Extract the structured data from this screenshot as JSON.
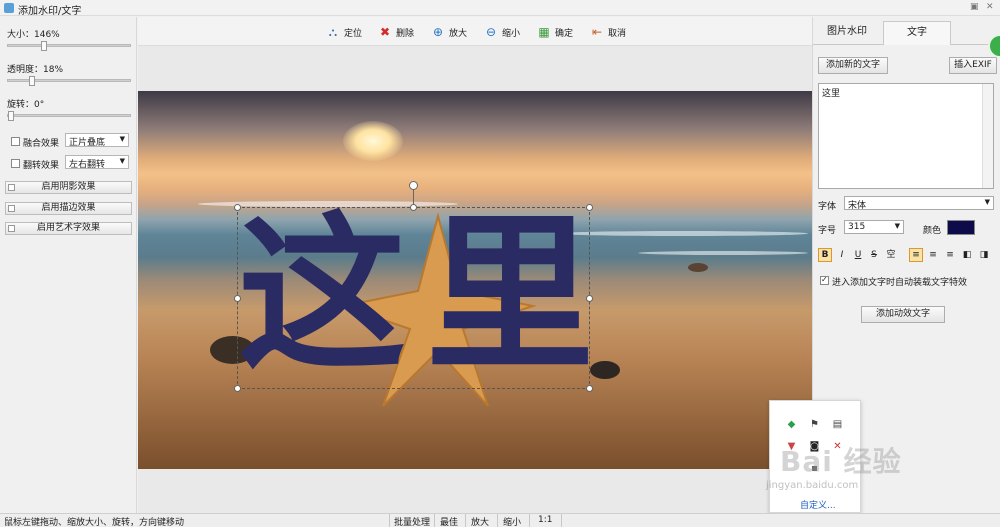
{
  "window": {
    "title": "添加水印/文字"
  },
  "left_panel": {
    "size_label": "大小：146%",
    "opacity_label": "透明度：18%",
    "rotate_label": "旋转：0°",
    "blend_checkbox_label": "融合效果",
    "blend_mode": "正片叠底",
    "flip_checkbox_label": "翻转效果",
    "flip_mode": "左右翻转",
    "shadow_button": "启用阴影效果",
    "stroke_button": "启用描边效果",
    "art_button": "启用艺术字效果",
    "size_slider_level": 0.28,
    "opacity_slider_level": 0.18,
    "rotate_slider_level": 0.0
  },
  "toolbar": {
    "locate": "定位",
    "delete": "删除",
    "zoom_in": "放大",
    "zoom_out": "缩小",
    "confirm": "确定",
    "cancel": "取消"
  },
  "canvas": {
    "watermark_text": "这里",
    "watermark_color": "#2a2b63"
  },
  "right_panel": {
    "tab_image_watermark": "图片水印",
    "tab_text": "文字",
    "add_text_button": "添加新的文字",
    "insert_exif_button": "插入EXIF",
    "text_value": "这里",
    "font_label": "字体",
    "font_value": "宋体",
    "size_label": "字号",
    "size_value": "315",
    "color_label": "颜色",
    "color_value": "#0d0b4a",
    "fmt_bold": "B",
    "fmt_italic": "I",
    "fmt_underline": "U",
    "fmt_strike": "S",
    "fmt_hollow": "空",
    "auto_effect_label": "进入添加文字时自动装载文字特效",
    "add_effect_button": "添加动效文字"
  },
  "float_menu": {
    "custom_link": "自定义..."
  },
  "watermark_overlay": {
    "logo": "Bai 经验",
    "url": "jingyan.baidu.com"
  },
  "statusbar": {
    "hint": "鼠标左键拖动、缩放大小、旋转，方向键移动",
    "batch": "批量处理",
    "best": "最佳",
    "zoom_in": "放大",
    "zoom_out": "缩小",
    "ratio": "1:1"
  }
}
